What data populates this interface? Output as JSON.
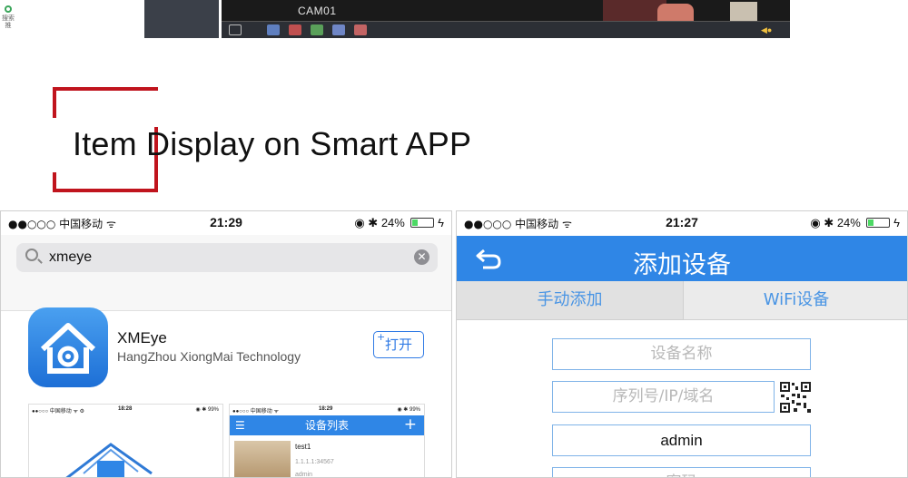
{
  "mini_widget": {
    "label": "搜索推"
  },
  "dvr": {
    "camera_label": "CAM01",
    "toolbar_icons": [
      "fullscreen-icon",
      "record-icon",
      "snapshot-icon",
      "playback-icon",
      "talk-icon",
      "stop-icon",
      "volume-icon"
    ]
  },
  "section": {
    "title": "Item Display on Smart APP"
  },
  "left_phone": {
    "status": {
      "carrier": "●●○○○ 中国移动 ᯤ",
      "time": "21:29",
      "battery": "24%"
    },
    "search": {
      "query": "xmeye",
      "clear_glyph": "✕"
    },
    "app": {
      "name": "XMEye",
      "developer": "HangZhou XiongMai Technology",
      "open_label": "打开",
      "open_plus": "+"
    },
    "screenshot1": {
      "carrier": "●●○○○ 中国移动 ᯤ ⚙",
      "time": "18:28",
      "battery": "◉ ✱ 99%"
    },
    "screenshot2": {
      "carrier": "●●○○○ 中国移动 ᯤ",
      "time": "18:29",
      "battery": "◉ ✱ 99%",
      "header_title": "设备列表",
      "menu_glyph": "☰",
      "add_glyph": "+",
      "device_name": "test1",
      "device_ip": "1.1.1.1:34567",
      "device_user": "admin"
    }
  },
  "right_phone": {
    "status": {
      "carrier": "●●○○○ 中国移动 ᯤ",
      "time": "21:27",
      "battery": "24%"
    },
    "nav_title": "添加设备",
    "tabs": [
      {
        "label": "手动添加"
      },
      {
        "label": "WiFi设备"
      }
    ],
    "fields": {
      "device_name_placeholder": "设备名称",
      "serial_placeholder": "序列号/IP/域名",
      "username_value": "admin",
      "password_placeholder": "密码"
    }
  },
  "colors": {
    "accent_blue": "#2f86e6",
    "bracket_red": "#c0141d"
  }
}
